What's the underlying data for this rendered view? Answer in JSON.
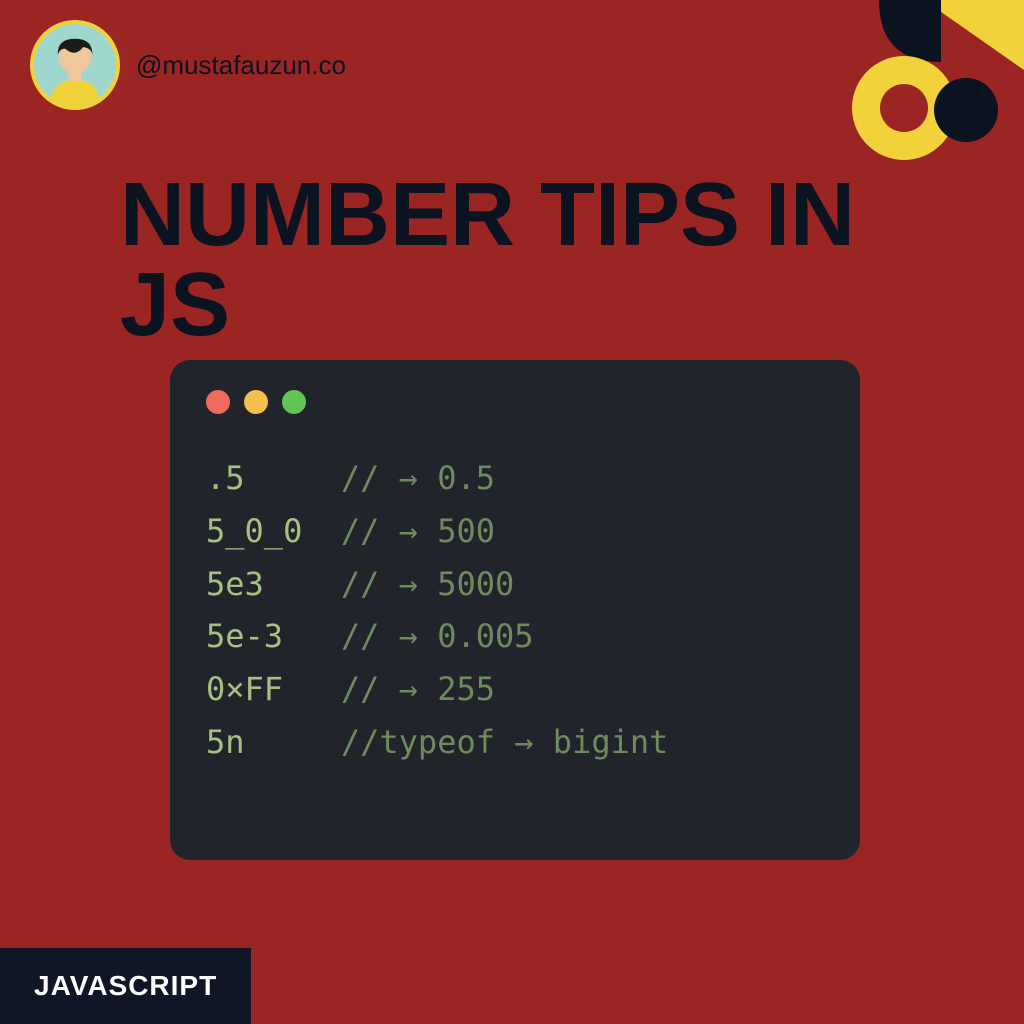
{
  "handle": "@mustafauzun.co",
  "title": "NUMBER TIPS IN JS",
  "tag": "JAVASCRIPT",
  "code": {
    "rows": [
      {
        "literal": ".5",
        "pad": "     ",
        "comment": "// → 0.5"
      },
      {
        "literal": "5_0_0",
        "pad": "  ",
        "comment": "// → 500"
      },
      {
        "literal": "5e3",
        "pad": "    ",
        "comment": "// → 5000"
      },
      {
        "literal": "5e-3",
        "pad": "   ",
        "comment": "// → 0.005"
      },
      {
        "literal": "0×FF",
        "pad": "   ",
        "comment": "// → 255"
      },
      {
        "literal": "5n",
        "pad": "     ",
        "comment": "//typeof → bigint"
      }
    ]
  }
}
